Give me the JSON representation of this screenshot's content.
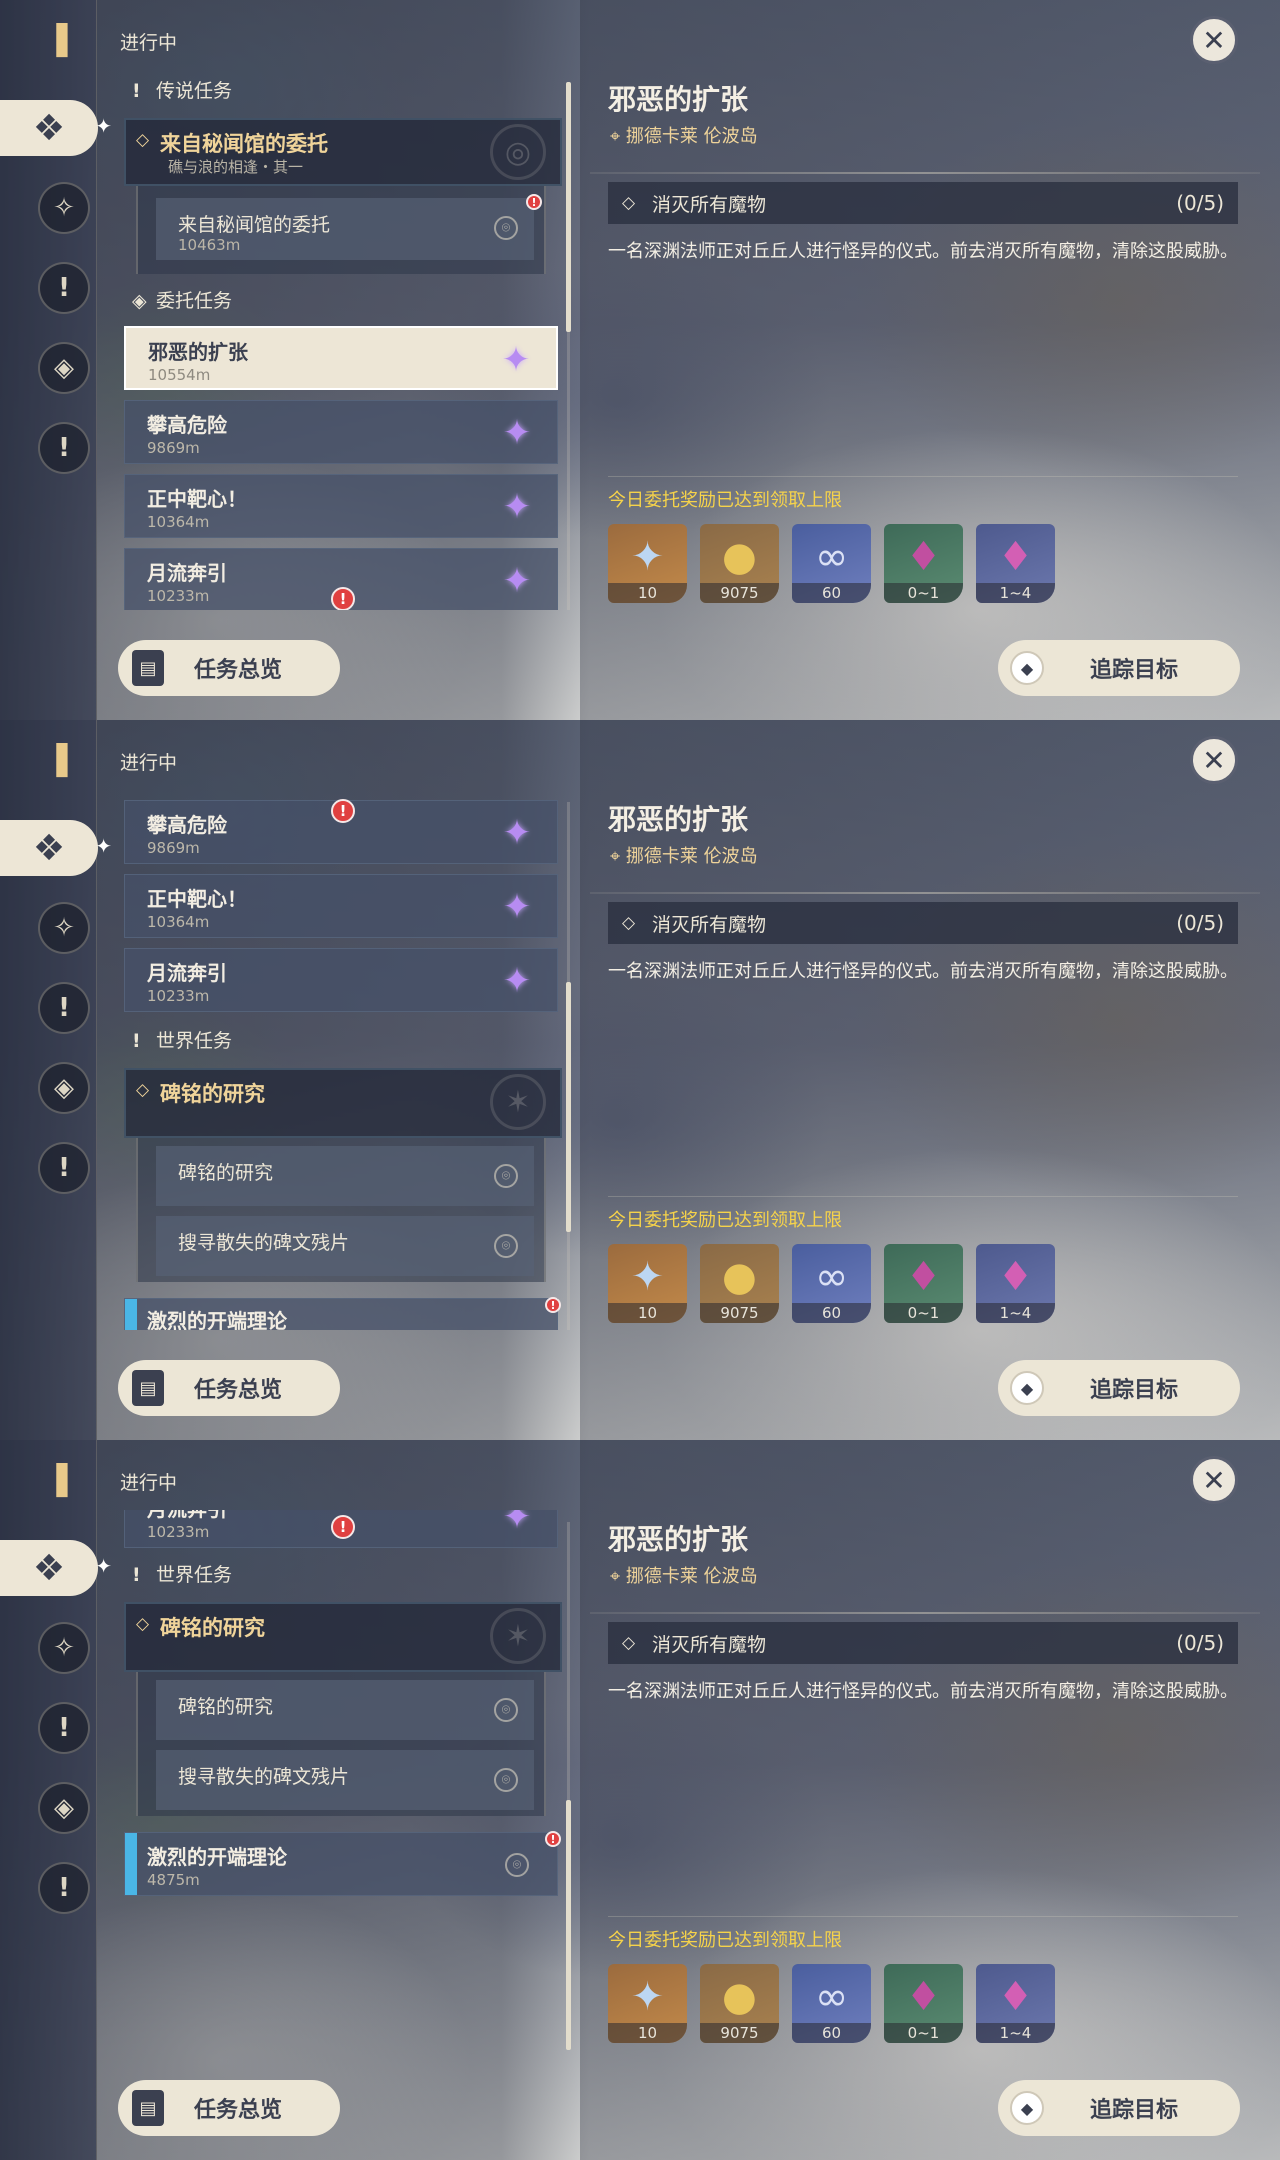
{
  "panels": [
    {
      "status": "进行中",
      "sections": {
        "legend": "传说任务",
        "commission": "委托任务",
        "world": "世界任务"
      },
      "legend_quest": {
        "title": "来自秘闻馆的委托",
        "subtitle": "礁与浪的相逢・其一",
        "step_title": "来自秘闻馆的委托",
        "step_dist": "10463m"
      },
      "commissions": [
        {
          "title": "邪恶的扩张",
          "dist": "10554m"
        },
        {
          "title": "攀高危险",
          "dist": "9869m"
        },
        {
          "title": "正中靶心！",
          "dist": "10364m"
        },
        {
          "title": "月流奔引",
          "dist": "10233m"
        }
      ]
    },
    {
      "status": "进行中",
      "commissions": [
        {
          "title": "攀高危险",
          "dist": "9869m"
        },
        {
          "title": "正中靶心！",
          "dist": "10364m"
        },
        {
          "title": "月流奔引",
          "dist": "10233m"
        }
      ],
      "world_section": "世界任务",
      "world_quest": {
        "title": "碑铭的研究",
        "steps": [
          "碑铭的研究",
          "搜寻散失的碑文残片"
        ]
      },
      "partial_quest": {
        "title": "激烈的开端理论"
      }
    },
    {
      "status": "进行中",
      "partial_commission": {
        "title": "月流奔引",
        "dist": "10233m"
      },
      "world_section": "世界任务",
      "world_quest": {
        "title": "碑铭的研究",
        "steps": [
          "碑铭的研究",
          "搜寻散失的碑文残片"
        ]
      },
      "quest": {
        "title": "激烈的开端理论",
        "dist": "4875m"
      }
    }
  ],
  "detail": {
    "title": "邪恶的扩张",
    "location": "挪德卡莱 伦波岛",
    "objective": "消灭所有魔物",
    "progress": "(0/5)",
    "description": "一名深渊法师正对丘丘人进行怪异的仪式。前去消灭所有魔物，清除这股威胁。",
    "reward_notice": "今日委托奖励已达到领取上限",
    "rewards": [
      {
        "icon": "primogem-icon",
        "amount": "10"
      },
      {
        "icon": "mora-icon",
        "amount": "9075"
      },
      {
        "icon": "companionship-exp-icon",
        "amount": "60"
      },
      {
        "icon": "crystal-ore-icon",
        "amount": "0~1"
      },
      {
        "icon": "crystal-cluster-icon",
        "amount": "1~4"
      }
    ]
  },
  "buttons": {
    "overview": "任务总览",
    "track": "追踪目标"
  },
  "colors": {
    "accent_gold": "#f0d49a",
    "notice_yellow": "#f6d34a",
    "alert_red": "#e04040",
    "panel_cream": "#ede6d6"
  }
}
